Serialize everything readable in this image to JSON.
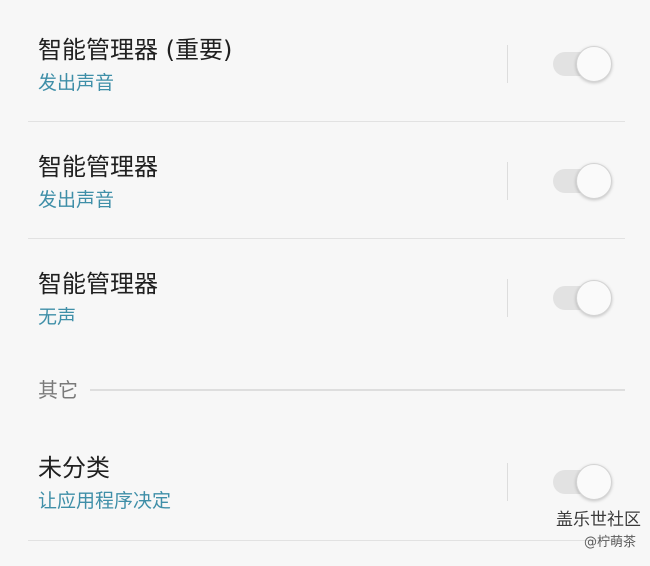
{
  "settings": {
    "items": [
      {
        "title": "智能管理器 (重要)",
        "subtitle": "发出声音",
        "enabled": false
      },
      {
        "title": "智能管理器",
        "subtitle": "发出声音",
        "enabled": false
      },
      {
        "title": "智能管理器",
        "subtitle": "无声",
        "enabled": false
      }
    ],
    "other_section": {
      "header": "其它",
      "items": [
        {
          "title": "未分类",
          "subtitle": "让应用程序决定",
          "enabled": false
        }
      ]
    }
  },
  "watermark": {
    "main": "盖乐世社区",
    "sub": "@柠萌茶"
  },
  "colors": {
    "background": "#f7f7f7",
    "subtitle": "#3f8fa8",
    "toggle_track_off": "#e2e2e2",
    "toggle_thumb": "#fafafa"
  }
}
